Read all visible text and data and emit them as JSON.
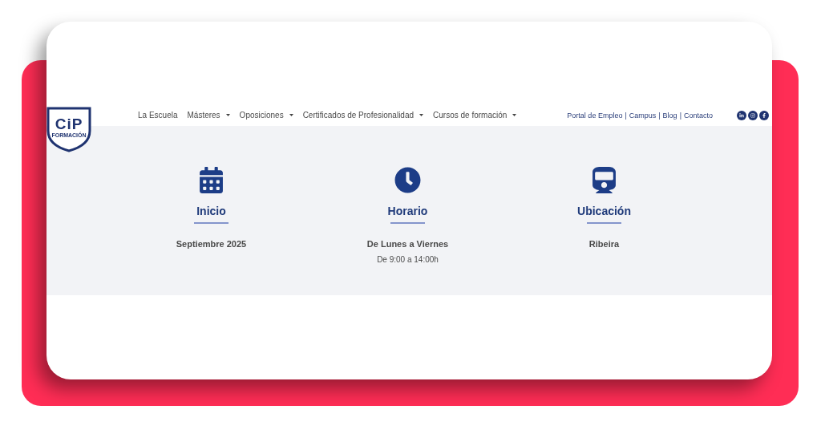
{
  "logo": {
    "title": "CiP",
    "subtitle": "FORMACIÓN"
  },
  "nav": [
    {
      "label": "La Escuela",
      "dropdown": false
    },
    {
      "label": "Másteres",
      "dropdown": true
    },
    {
      "label": "Oposiciones",
      "dropdown": true
    },
    {
      "label": "Certificados de Profesionalidad",
      "dropdown": true
    },
    {
      "label": "Cursos de formación",
      "dropdown": true
    }
  ],
  "top_links": [
    "Portal de Empleo",
    "Campus",
    "Blog",
    "Contacto"
  ],
  "link_separator": "|",
  "features": [
    {
      "title": "Inicio",
      "lines": [
        "Septiembre 2025"
      ]
    },
    {
      "title": "Horario",
      "lines": [
        "De Lunes a Viernes",
        "De 9:00 a 14:00h"
      ]
    },
    {
      "title": "Ubicación",
      "lines": [
        "Ribeira"
      ]
    }
  ]
}
